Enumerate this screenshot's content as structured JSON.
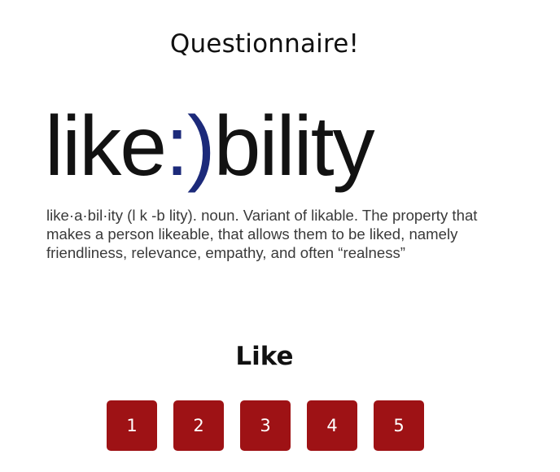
{
  "page": {
    "title": "Questionnaire!"
  },
  "hero": {
    "wordmark_prefix": "like",
    "wordmark_emoticon": ":)",
    "wordmark_suffix": "bility",
    "definition": "like·a·bil·ity (l k -b lity). noun. Variant of likable. The property that makes a person likeable, that allows them to be liked, namely friendliness, relevance, empathy, and often “realness”",
    "colors": {
      "text": "#121212",
      "emoticon": "#1c2a7a"
    }
  },
  "question": {
    "label": "Like",
    "options": [
      "1",
      "2",
      "3",
      "4",
      "5"
    ],
    "button_color": "#9e1215"
  }
}
